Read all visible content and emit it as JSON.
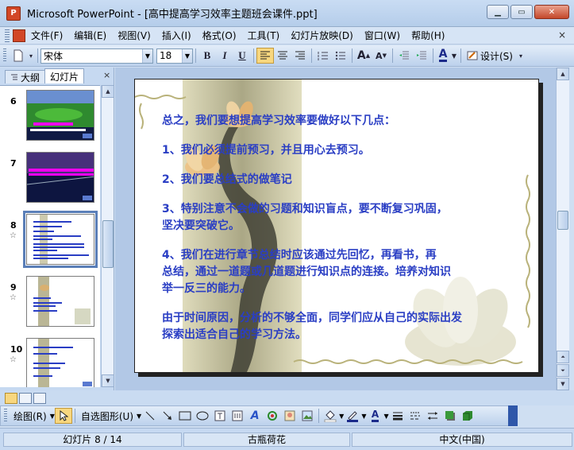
{
  "window": {
    "title": "Microsoft PowerPoint - [高中提高学习效率主题班会课件.ppt]",
    "app_icon": "powerpoint-icon",
    "controls": {
      "minimize": "▁",
      "maximize": "▭",
      "close": "✕"
    }
  },
  "menu": {
    "items": [
      "文件(F)",
      "编辑(E)",
      "视图(V)",
      "插入(I)",
      "格式(O)",
      "工具(T)",
      "幻灯片放映(D)",
      "窗口(W)",
      "帮助(H)"
    ],
    "close_glyph": "×"
  },
  "toolbar": {
    "font_name": "宋体",
    "font_size": "18",
    "bold": "B",
    "italic": "I",
    "underline": "U",
    "increase_font": "A",
    "decrease_font": "A",
    "font_color": "A",
    "design_label": "设计(S)",
    "active_alignment": "align-left"
  },
  "panel": {
    "tabs": [
      "大纲",
      "幻灯片"
    ],
    "active_tab": "幻灯片",
    "close_glyph": "×",
    "thumbnails": [
      {
        "number": "6",
        "selected": false,
        "has_star": false
      },
      {
        "number": "7",
        "selected": false,
        "has_star": false
      },
      {
        "number": "8",
        "selected": true,
        "has_star": true
      },
      {
        "number": "9",
        "selected": false,
        "has_star": true
      },
      {
        "number": "10",
        "selected": false,
        "has_star": true
      }
    ]
  },
  "slide": {
    "lines": [
      "总之，我们要想提高学习效率要做好以下几点：",
      "",
      "1、我们必须提前预习，并且用心去预习。",
      "",
      "2、我们要总结式的做笔记",
      "",
      "3、特别注意不会做的习题和知识盲点，要不断复习巩固，",
      "坚决要突破它。",
      "",
      "4、我们在进行章节总结时应该通过先回忆，再看书，再",
      "总结，通过一道题或几道题进行知识点的连接。培养对知识",
      "举一反三的能力。",
      "",
      "由于时间原因，分析的不够全面，同学们应从自己的实际出发",
      "探索出适合自己的学习方法。"
    ],
    "text_color": "#2a3ec4"
  },
  "drawing_toolbar": {
    "draw_label": "绘图(R)",
    "autoshapes_label": "自选图形(U)"
  },
  "status": {
    "slide_indicator": "幻灯片 8 / 14",
    "design_template": "古瓶荷花",
    "language": "中文(中国)"
  }
}
